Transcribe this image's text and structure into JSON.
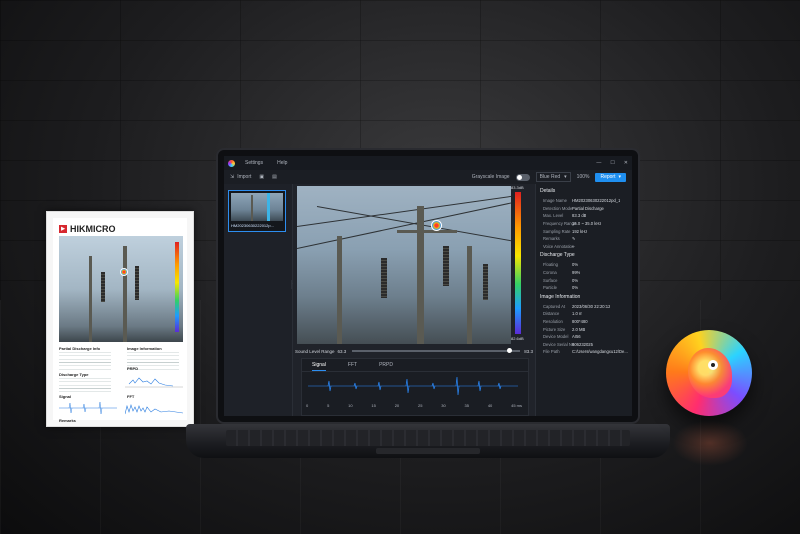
{
  "app": {
    "menu": [
      "Settings",
      "Help"
    ],
    "window_controls": [
      "—",
      "☐",
      "✕"
    ]
  },
  "toolbar": {
    "import_label": "Import",
    "grayscale_label": "Grayscale Image",
    "palette_label": "Blue Red",
    "zoom": "100%",
    "report_label": "Report"
  },
  "thumbnail": {
    "label": "HM20230630222012p..."
  },
  "viewer": {
    "scale_max": "83.3dB",
    "scale_min": "82.6dB",
    "sound_level_label": "Sound Level Range",
    "sound_level_min": "63.3",
    "sound_level_max": "83.3",
    "sound_level_fraction": 0.92
  },
  "wave_tabs": [
    "Signal",
    "FFT",
    "PRPD"
  ],
  "wave_axis": [
    "0",
    "5",
    "10",
    "15",
    "20",
    "25",
    "30",
    "35",
    "40",
    "45 ms"
  ],
  "details": {
    "title": "Details",
    "rows": [
      {
        "k": "Image Name",
        "v": "HM20230630222012pd_1"
      },
      {
        "k": "Detection Mode",
        "v": "Partial Discharge"
      },
      {
        "k": "Max. Level",
        "v": "83.3 dB"
      },
      {
        "k": "Frequency Range",
        "v": "15.0 ~ 35.0 kHz"
      },
      {
        "k": "Sampling Rate",
        "v": "192 kHz"
      },
      {
        "k": "Remarks",
        "v": "✎"
      },
      {
        "k": "Voice Annotation",
        "v": "--"
      }
    ]
  },
  "discharge": {
    "title": "Discharge Type",
    "rows": [
      {
        "k": "Floating",
        "v": "0%"
      },
      {
        "k": "Corona",
        "v": "99%"
      },
      {
        "k": "Surface",
        "v": "0%"
      },
      {
        "k": "Particle",
        "v": "0%"
      }
    ]
  },
  "image_info": {
    "title": "Image Information",
    "rows": [
      {
        "k": "Captured At",
        "v": "2023/06/30 22:20:12"
      },
      {
        "k": "Distance",
        "v": "1.0 m"
      },
      {
        "k": "Resolution",
        "v": "800*480"
      },
      {
        "k": "Picture Size",
        "v": "2.0 MB"
      },
      {
        "k": "Device Model",
        "v": "AI56"
      },
      {
        "k": "Device Serial No.",
        "v": "906232025"
      },
      {
        "k": "File Path",
        "v": "C:/Users/wangdangxu12/De..."
      }
    ]
  },
  "paper": {
    "brand": "HIKMICRO",
    "sections": [
      "Partial Discharge Info",
      "Image Information",
      "Discharge Type",
      "PRPD",
      "Signal",
      "FFT",
      "Remarks"
    ]
  },
  "colors": {
    "accent": "#1f8ff0",
    "panel": "#1b1e24"
  }
}
